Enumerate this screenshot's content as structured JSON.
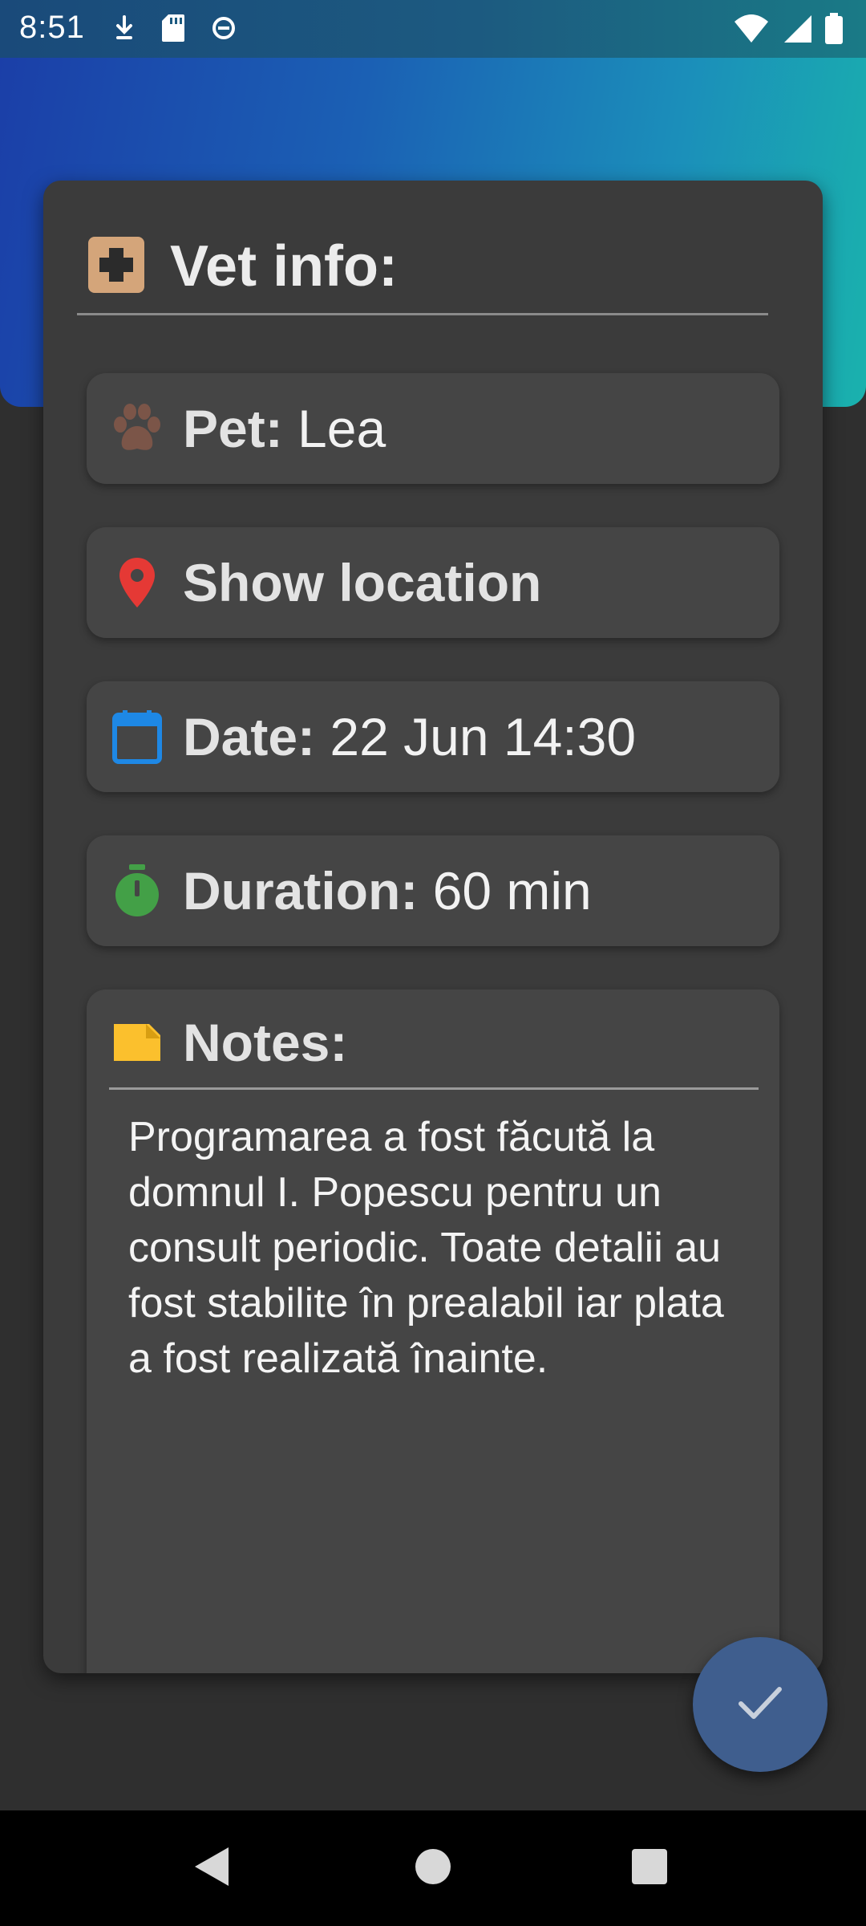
{
  "status_bar": {
    "time": "8:51",
    "left_icons": [
      "download-icon",
      "sd-card-icon",
      "sync-icon"
    ],
    "right_icons": [
      "wifi-icon",
      "cellular-signal-icon",
      "battery-icon"
    ]
  },
  "card": {
    "title": "Vet info:",
    "title_icon": "medical-cross-icon",
    "title_icon_color": "#d4a57a",
    "rows": [
      {
        "icon": "paw-icon",
        "icon_color": "#7b5548",
        "label": "Pet:",
        "value": "Lea"
      },
      {
        "icon": "location-pin-icon",
        "icon_color": "#e53935",
        "label": "Show location",
        "value": ""
      },
      {
        "icon": "calendar-icon",
        "icon_color": "#1e88e5",
        "label": "Date:",
        "value": "22 Jun 14:30"
      },
      {
        "icon": "timer-icon",
        "icon_color": "#43a047",
        "label": "Duration:",
        "value": "60 min"
      }
    ],
    "notes": {
      "title": "Notes:",
      "icon": "note-icon",
      "icon_color": "#fbc02d",
      "text": "Programarea a fost făcută la domnul I. Popescu pentru un consult periodic. Toate detalii au fost stabilite în prealabil iar plata a fost realizată înainte."
    }
  },
  "fab": {
    "icon": "check-icon",
    "color": "#3f5e8e"
  },
  "nav_bar": {
    "buttons": [
      "back-icon",
      "home-icon",
      "recents-icon"
    ]
  },
  "colors": {
    "background": "#2f2f2f",
    "card": "#3b3b3b",
    "row": "#454545",
    "header_gradient_start": "#1b3fa8",
    "header_gradient_end": "#1ab2ad"
  }
}
